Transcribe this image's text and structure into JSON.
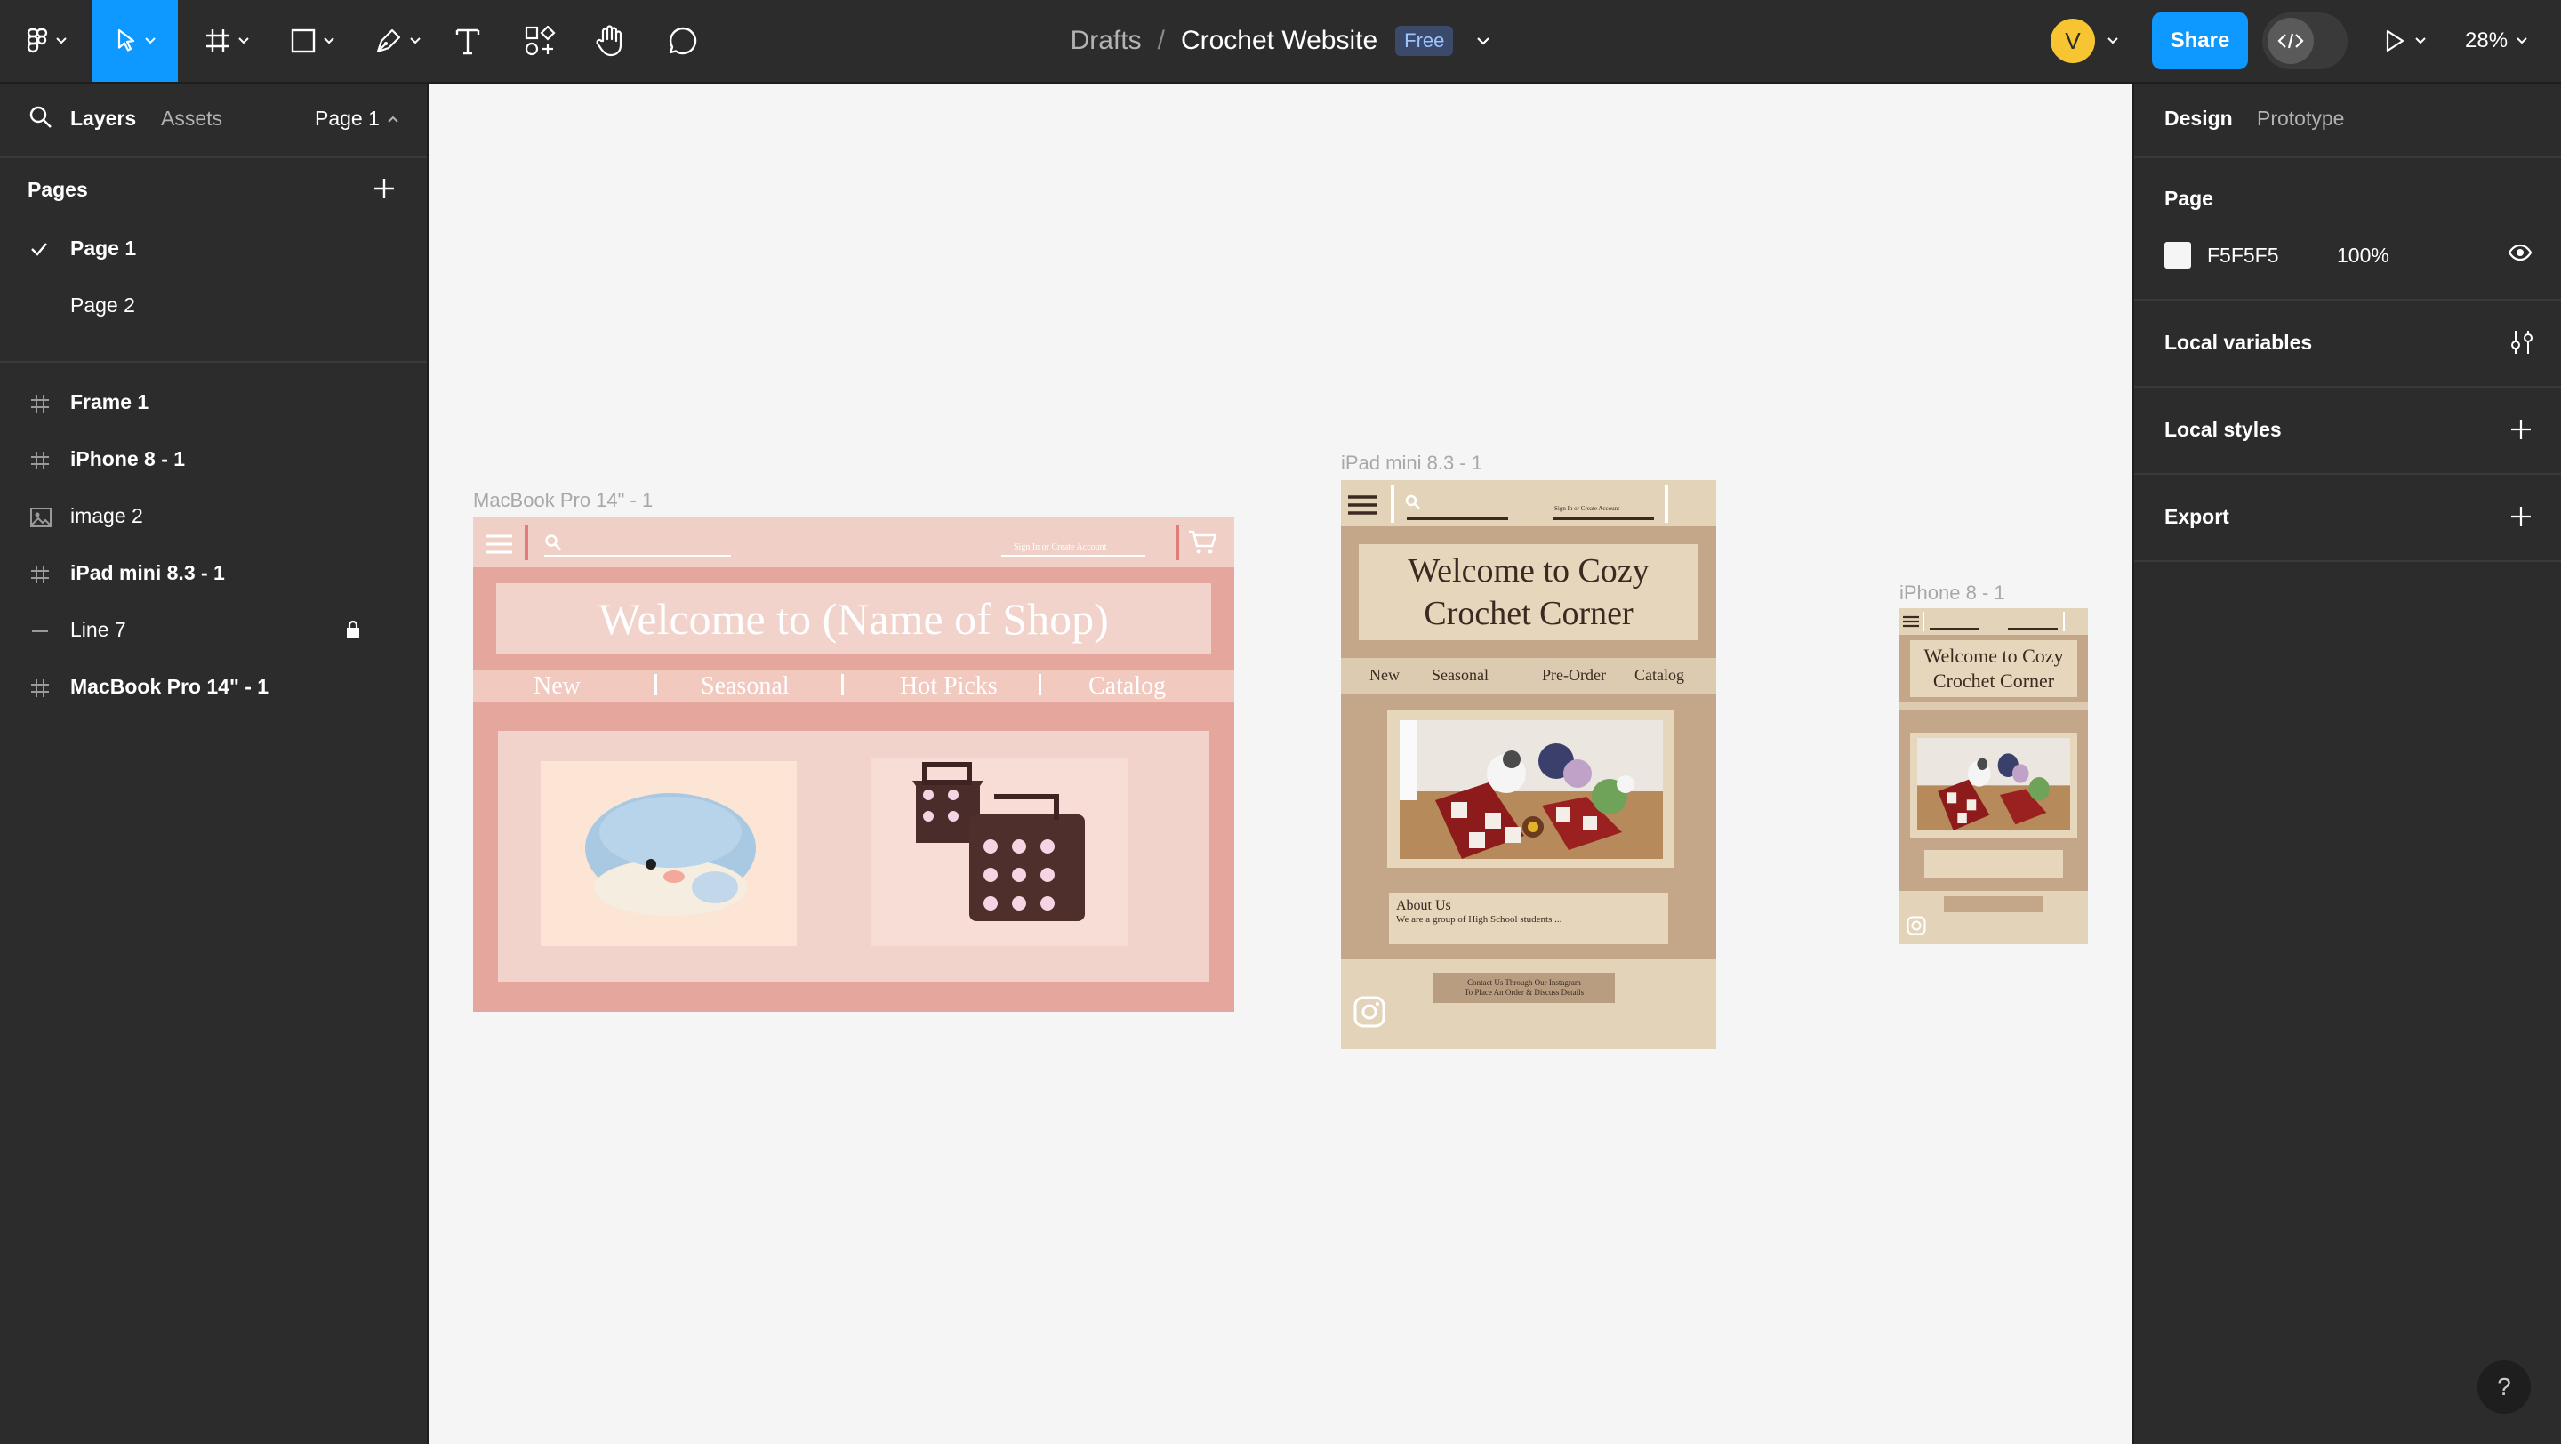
{
  "toolbar": {
    "breadcrumb_drafts": "Drafts",
    "breadcrumb_sep": "/",
    "file_name": "Crochet Website",
    "plan_badge": "Free",
    "avatar_initial": "V",
    "share_label": "Share",
    "zoom_level": "28%",
    "tools": [
      "figma-menu-icon",
      "move-tool-icon",
      "frame-tool-icon",
      "shape-tool-icon",
      "pen-tool-icon",
      "text-tool-icon",
      "components-icon",
      "hand-tool-icon",
      "comment-icon"
    ],
    "active_tool": "move-tool-icon",
    "accent_color": "#0d99ff"
  },
  "left_panel": {
    "tabs": [
      "Layers",
      "Assets"
    ],
    "active_tab": "Layers",
    "page_selector": "Page 1",
    "pages_heading": "Pages",
    "pages": [
      {
        "label": "Page 1",
        "selected": true
      },
      {
        "label": "Page 2",
        "selected": false
      }
    ],
    "layers": [
      {
        "label": "Frame 1",
        "icon": "frame-icon",
        "locked": false
      },
      {
        "label": "iPhone 8 - 1",
        "icon": "frame-icon",
        "locked": false
      },
      {
        "label": "image 2",
        "icon": "image-icon",
        "locked": false
      },
      {
        "label": "iPad mini 8.3 - 1",
        "icon": "frame-icon",
        "locked": false
      },
      {
        "label": "Line 7",
        "icon": "line-icon",
        "locked": true
      },
      {
        "label": "MacBook Pro 14\" - 1",
        "icon": "frame-icon",
        "locked": false
      }
    ]
  },
  "right_panel": {
    "tabs": [
      "Design",
      "Prototype"
    ],
    "active_tab": "Design",
    "page_heading": "Page",
    "page_color": "F5F5F5",
    "page_opacity": "100%",
    "sections": [
      "Local variables",
      "Local styles",
      "Export"
    ]
  },
  "canvas": {
    "background": "#f5f5f5",
    "macbook": {
      "label": "MacBook Pro 14\" - 1",
      "sign_in": "Sign In or Create Account",
      "title": "Welcome to (Name of Shop)",
      "nav": [
        "New",
        "Seasonal",
        "Hot Picks",
        "Catalog"
      ]
    },
    "ipad": {
      "label": "iPad mini 8.3 - 1",
      "sign_in": "Sign In or Create Account",
      "title": "Welcome to Cozy Crochet Corner",
      "nav": [
        "New",
        "Seasonal",
        "Pre-Order",
        "Catalog"
      ],
      "about_heading": "About Us",
      "about_text": "We are a group of High School students ...",
      "contact_line1": "Contact Us Through Our Instagram",
      "contact_line2": "To Place An Order & Discuss Details"
    },
    "iphone": {
      "label": "iPhone 8 - 1",
      "title": "Welcome to Cozy Crochet Corner"
    }
  },
  "help_label": "?"
}
